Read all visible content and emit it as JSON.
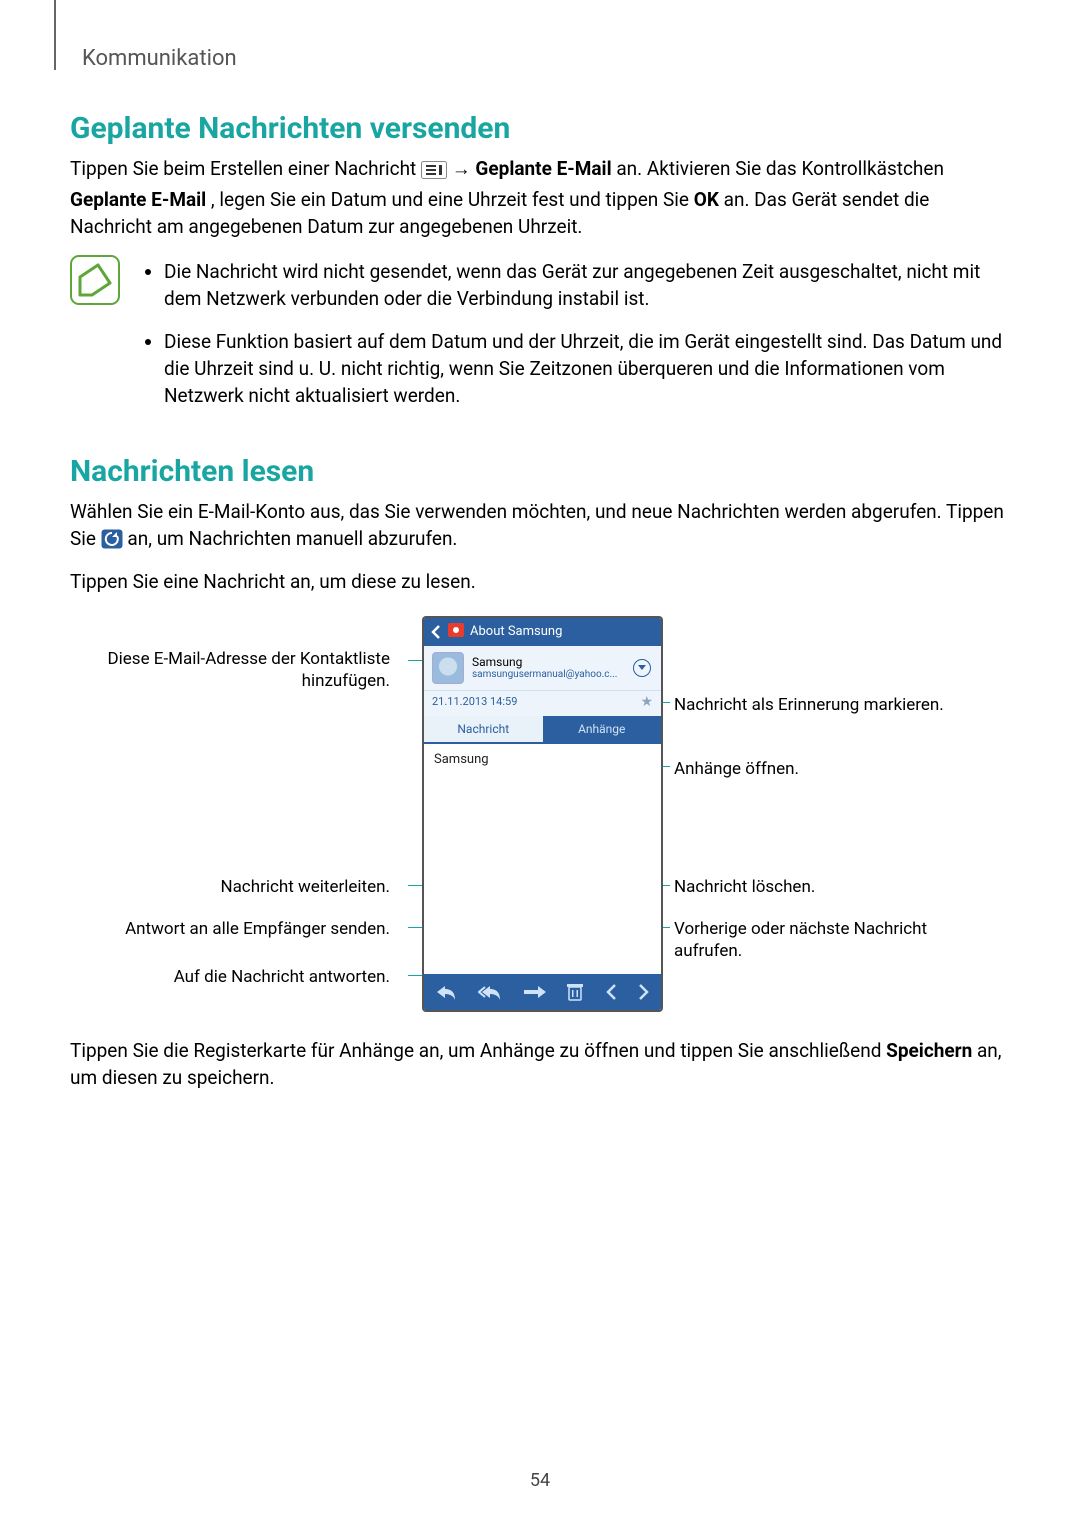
{
  "header": {
    "section": "Kommunikation"
  },
  "s1": {
    "heading": "Geplante Nachrichten versenden",
    "p1_a": "Tippen Sie beim Erstellen einer Nachricht ",
    "p1_arrow": " → ",
    "p1_bold1": "Geplante E-Mail",
    "p1_b": " an. Aktivieren Sie das Kontrollkästchen ",
    "p1_bold2": "Geplante E-Mail",
    "p1_c": ", legen Sie ein Datum und eine Uhrzeit fest und tippen Sie ",
    "p1_bold3": "OK",
    "p1_d": " an. Das Gerät sendet die Nachricht am angegebenen Datum zur angegebenen Uhrzeit.",
    "bullets": [
      "Die Nachricht wird nicht gesendet, wenn das Gerät zur angegebenen Zeit ausgeschaltet, nicht mit dem Netzwerk verbunden oder die Verbindung instabil ist.",
      "Diese Funktion basiert auf dem Datum und der Uhrzeit, die im Gerät eingestellt sind. Das Datum und die Uhrzeit sind u. U. nicht richtig, wenn Sie Zeitzonen überqueren und die Informationen vom Netzwerk nicht aktualisiert werden."
    ]
  },
  "s2": {
    "heading": "Nachrichten lesen",
    "p1": "Wählen Sie ein E-Mail-Konto aus, das Sie verwenden möchten, und neue Nachrichten werden abgerufen. Tippen Sie ",
    "p1_tail": " an, um Nachrichten manuell abzurufen.",
    "p2": "Tippen Sie eine Nachricht an, um diese zu lesen.",
    "p3_a": "Tippen Sie die Registerkarte für Anhänge an, um Anhänge zu öffnen und tippen Sie anschließend ",
    "p3_bold": "Speichern",
    "p3_b": " an, um diesen zu speichern."
  },
  "callouts": {
    "left1": "Diese E-Mail-Adresse der Kontaktliste hinzufügen.",
    "left2": "Nachricht weiterleiten.",
    "left3": "Antwort an alle Empfänger senden.",
    "left4": "Auf die Nachricht antworten.",
    "right1": "Nachricht als Erinnerung markieren.",
    "right2": "Anhänge öffnen.",
    "right3": "Nachricht löschen.",
    "right4": "Vorherige oder nächste Nachricht aufrufen."
  },
  "phone": {
    "title": "About Samsung",
    "sender": "Samsung",
    "email": "samsungusermanual@yahoo.c...",
    "datetime": "21.11.2013  14:59",
    "tab_msg": "Nachricht",
    "tab_att": "Anhänge",
    "body": "Samsung"
  },
  "pagenum": "54"
}
